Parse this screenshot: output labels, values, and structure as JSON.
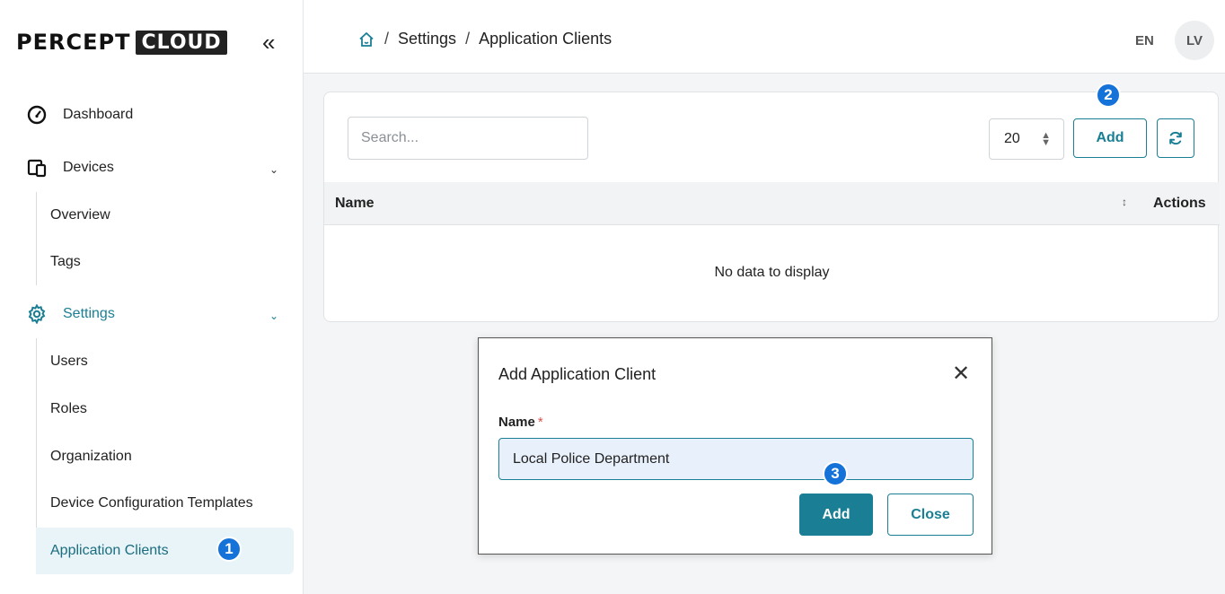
{
  "logo": {
    "percept": "PERCEPT",
    "cloud": "CLOUD",
    "collapse_glyph": "«"
  },
  "sidebar": {
    "dashboard": {
      "label": "Dashboard",
      "icon": "gauge-icon"
    },
    "devices": {
      "label": "Devices",
      "icon": "devices-icon",
      "children": [
        "Overview",
        "Tags"
      ]
    },
    "settings": {
      "label": "Settings",
      "icon": "gear-icon",
      "children": [
        "Users",
        "Roles",
        "Organization",
        "Device Configuration Templates",
        "Application Clients"
      ]
    }
  },
  "badges": {
    "one": "1",
    "two": "2",
    "three": "3"
  },
  "breadcrumb": {
    "home_icon": "home-icon",
    "items": [
      "Settings",
      "Application Clients"
    ],
    "separator": "/"
  },
  "header": {
    "lang": "EN",
    "avatar": "LV"
  },
  "toolbar": {
    "search_placeholder": "Search...",
    "page_size": "20",
    "add_label": "Add"
  },
  "table": {
    "columns": [
      "Name",
      "Actions"
    ],
    "empty_text": "No data to display"
  },
  "modal": {
    "title": "Add Application Client",
    "field_label": "Name",
    "required_mark": "*",
    "field_value": "Local Police Department",
    "add_label": "Add",
    "close_label": "Close"
  },
  "colors": {
    "accent": "#1a7f94",
    "badge": "#1572d8",
    "active_bg": "#e8f4f7"
  }
}
